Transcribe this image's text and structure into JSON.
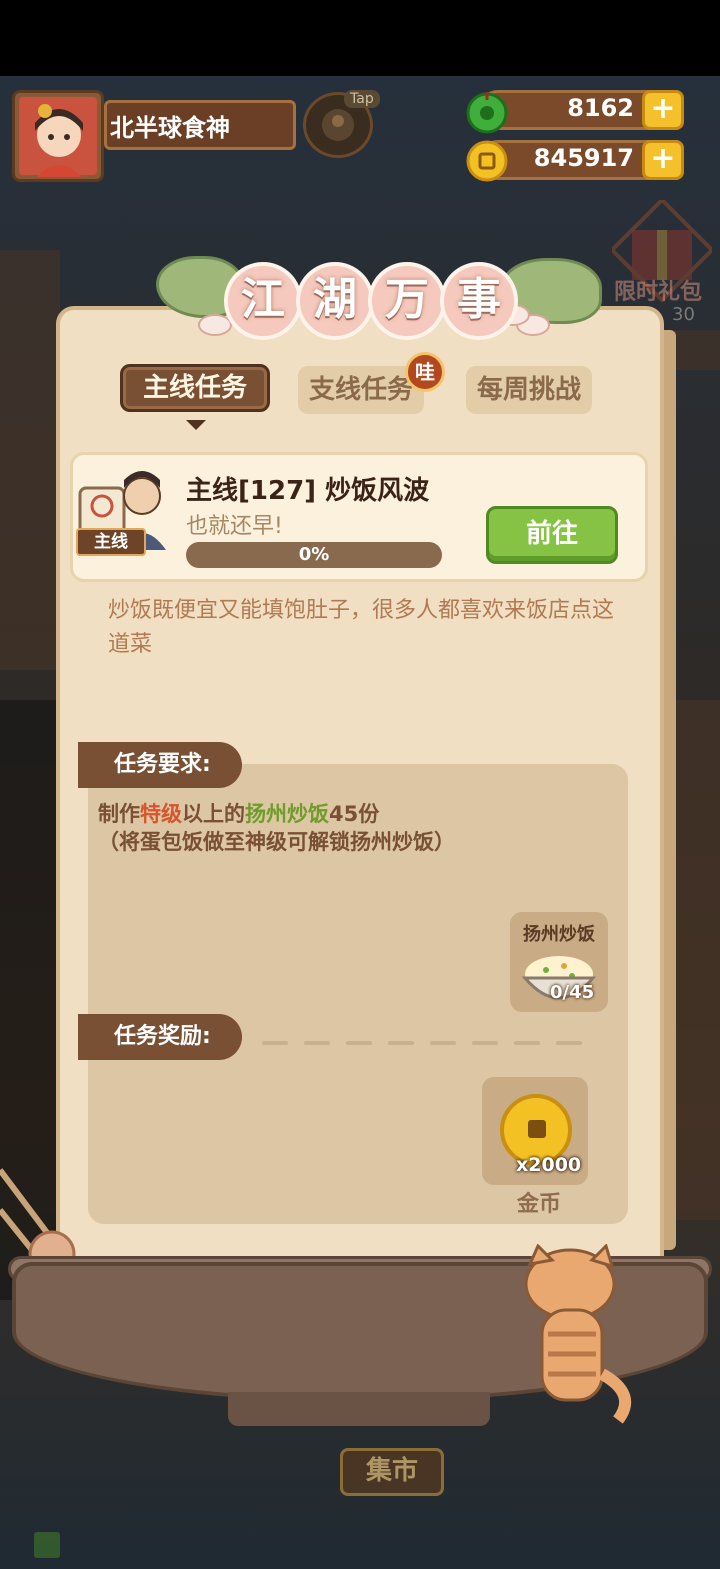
{
  "player": {
    "name": "北半球食神",
    "tap_label": "Tap"
  },
  "currency": {
    "jade": {
      "value": "8162",
      "icon": "jade-icon",
      "plus": "+"
    },
    "coins": {
      "value": "845917",
      "icon": "coin-icon",
      "plus": "+"
    }
  },
  "side": {
    "gift_label": "限时礼包",
    "gift_timer": "30"
  },
  "panel": {
    "title_chars": [
      "江",
      "湖",
      "万",
      "事"
    ],
    "tabs": [
      {
        "label": "主线任务",
        "active": true
      },
      {
        "label": "支线任务",
        "active": false,
        "badge": "哇"
      },
      {
        "label": "每周挑战",
        "active": false
      }
    ]
  },
  "quest": {
    "tag": "主线",
    "title": "主线[127] 炒饭风波",
    "subtitle": "也就还早!",
    "progress_text": "0%",
    "progress": 0,
    "go_button": "前往",
    "description": "炒饭既便宜又能填饱肚子，很多人都喜欢来饭店点这道菜"
  },
  "requirements": {
    "label": "任务要求:",
    "line1_prefix": "制作",
    "line1_grade": "特级",
    "line1_mid": "以上的",
    "line1_dish": "扬州炒饭",
    "line1_suffix": "45份",
    "line2": "（将蛋包饭做至神级可解锁扬州炒饭）",
    "item_name": "扬州炒饭",
    "item_count": "0/45"
  },
  "rewards": {
    "label": "任务奖励:",
    "items": [
      {
        "name": "金币",
        "qty": "x2000",
        "icon": "coin-icon"
      }
    ]
  },
  "bottom": {
    "market": "集市"
  },
  "colors": {
    "panel": "#f0dfc2",
    "accent_brown": "#7a5035",
    "go_green": "#86c244",
    "gold": "#f4c124"
  }
}
